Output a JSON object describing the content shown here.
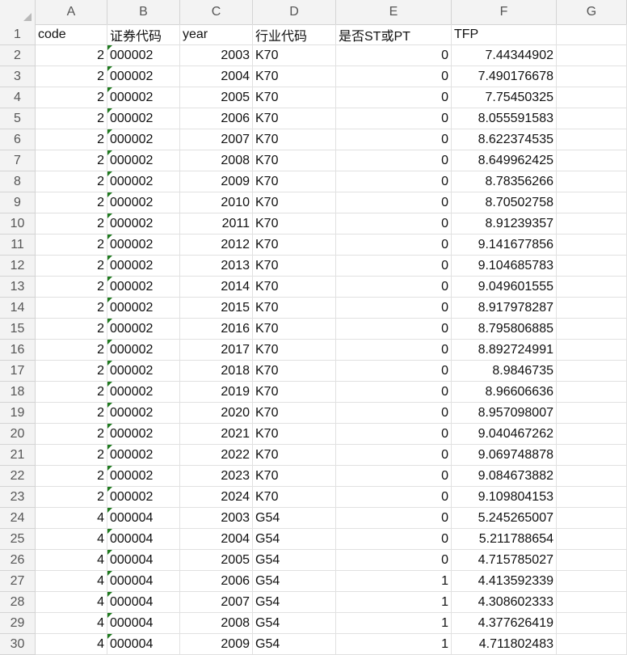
{
  "sheet": {
    "columns": [
      "A",
      "B",
      "C",
      "D",
      "E",
      "F",
      "G"
    ],
    "header_row": {
      "number": "1",
      "cells": [
        "code",
        "证券代码",
        "year",
        "行业代码",
        "是否ST或PT",
        "TFP",
        ""
      ]
    },
    "rows": [
      {
        "n": "2",
        "a": "2",
        "b": "000002",
        "c": "2003",
        "d": "K70",
        "e": "0",
        "f": "7.44344902"
      },
      {
        "n": "3",
        "a": "2",
        "b": "000002",
        "c": "2004",
        "d": "K70",
        "e": "0",
        "f": "7.490176678"
      },
      {
        "n": "4",
        "a": "2",
        "b": "000002",
        "c": "2005",
        "d": "K70",
        "e": "0",
        "f": "7.75450325"
      },
      {
        "n": "5",
        "a": "2",
        "b": "000002",
        "c": "2006",
        "d": "K70",
        "e": "0",
        "f": "8.055591583"
      },
      {
        "n": "6",
        "a": "2",
        "b": "000002",
        "c": "2007",
        "d": "K70",
        "e": "0",
        "f": "8.622374535"
      },
      {
        "n": "7",
        "a": "2",
        "b": "000002",
        "c": "2008",
        "d": "K70",
        "e": "0",
        "f": "8.649962425"
      },
      {
        "n": "8",
        "a": "2",
        "b": "000002",
        "c": "2009",
        "d": "K70",
        "e": "0",
        "f": "8.78356266"
      },
      {
        "n": "9",
        "a": "2",
        "b": "000002",
        "c": "2010",
        "d": "K70",
        "e": "0",
        "f": "8.70502758"
      },
      {
        "n": "10",
        "a": "2",
        "b": "000002",
        "c": "2011",
        "d": "K70",
        "e": "0",
        "f": "8.91239357"
      },
      {
        "n": "11",
        "a": "2",
        "b": "000002",
        "c": "2012",
        "d": "K70",
        "e": "0",
        "f": "9.141677856"
      },
      {
        "n": "12",
        "a": "2",
        "b": "000002",
        "c": "2013",
        "d": "K70",
        "e": "0",
        "f": "9.104685783"
      },
      {
        "n": "13",
        "a": "2",
        "b": "000002",
        "c": "2014",
        "d": "K70",
        "e": "0",
        "f": "9.049601555"
      },
      {
        "n": "14",
        "a": "2",
        "b": "000002",
        "c": "2015",
        "d": "K70",
        "e": "0",
        "f": "8.917978287"
      },
      {
        "n": "15",
        "a": "2",
        "b": "000002",
        "c": "2016",
        "d": "K70",
        "e": "0",
        "f": "8.795806885"
      },
      {
        "n": "16",
        "a": "2",
        "b": "000002",
        "c": "2017",
        "d": "K70",
        "e": "0",
        "f": "8.892724991"
      },
      {
        "n": "17",
        "a": "2",
        "b": "000002",
        "c": "2018",
        "d": "K70",
        "e": "0",
        "f": "8.9846735"
      },
      {
        "n": "18",
        "a": "2",
        "b": "000002",
        "c": "2019",
        "d": "K70",
        "e": "0",
        "f": "8.96606636"
      },
      {
        "n": "19",
        "a": "2",
        "b": "000002",
        "c": "2020",
        "d": "K70",
        "e": "0",
        "f": "8.957098007"
      },
      {
        "n": "20",
        "a": "2",
        "b": "000002",
        "c": "2021",
        "d": "K70",
        "e": "0",
        "f": "9.040467262"
      },
      {
        "n": "21",
        "a": "2",
        "b": "000002",
        "c": "2022",
        "d": "K70",
        "e": "0",
        "f": "9.069748878"
      },
      {
        "n": "22",
        "a": "2",
        "b": "000002",
        "c": "2023",
        "d": "K70",
        "e": "0",
        "f": "9.084673882"
      },
      {
        "n": "23",
        "a": "2",
        "b": "000002",
        "c": "2024",
        "d": "K70",
        "e": "0",
        "f": "9.109804153"
      },
      {
        "n": "24",
        "a": "4",
        "b": "000004",
        "c": "2003",
        "d": "G54",
        "e": "0",
        "f": "5.245265007"
      },
      {
        "n": "25",
        "a": "4",
        "b": "000004",
        "c": "2004",
        "d": "G54",
        "e": "0",
        "f": "5.211788654"
      },
      {
        "n": "26",
        "a": "4",
        "b": "000004",
        "c": "2005",
        "d": "G54",
        "e": "0",
        "f": "4.715785027"
      },
      {
        "n": "27",
        "a": "4",
        "b": "000004",
        "c": "2006",
        "d": "G54",
        "e": "1",
        "f": "4.413592339"
      },
      {
        "n": "28",
        "a": "4",
        "b": "000004",
        "c": "2007",
        "d": "G54",
        "e": "1",
        "f": "4.308602333"
      },
      {
        "n": "29",
        "a": "4",
        "b": "000004",
        "c": "2008",
        "d": "G54",
        "e": "1",
        "f": "4.377626419"
      },
      {
        "n": "30",
        "a": "4",
        "b": "000004",
        "c": "2009",
        "d": "G54",
        "e": "1",
        "f": "4.711802483"
      }
    ]
  },
  "colors": {
    "header_bg": "#f3f3f3",
    "grid": "#e1e1e1",
    "text_number_marker": "#1f7a1f"
  }
}
